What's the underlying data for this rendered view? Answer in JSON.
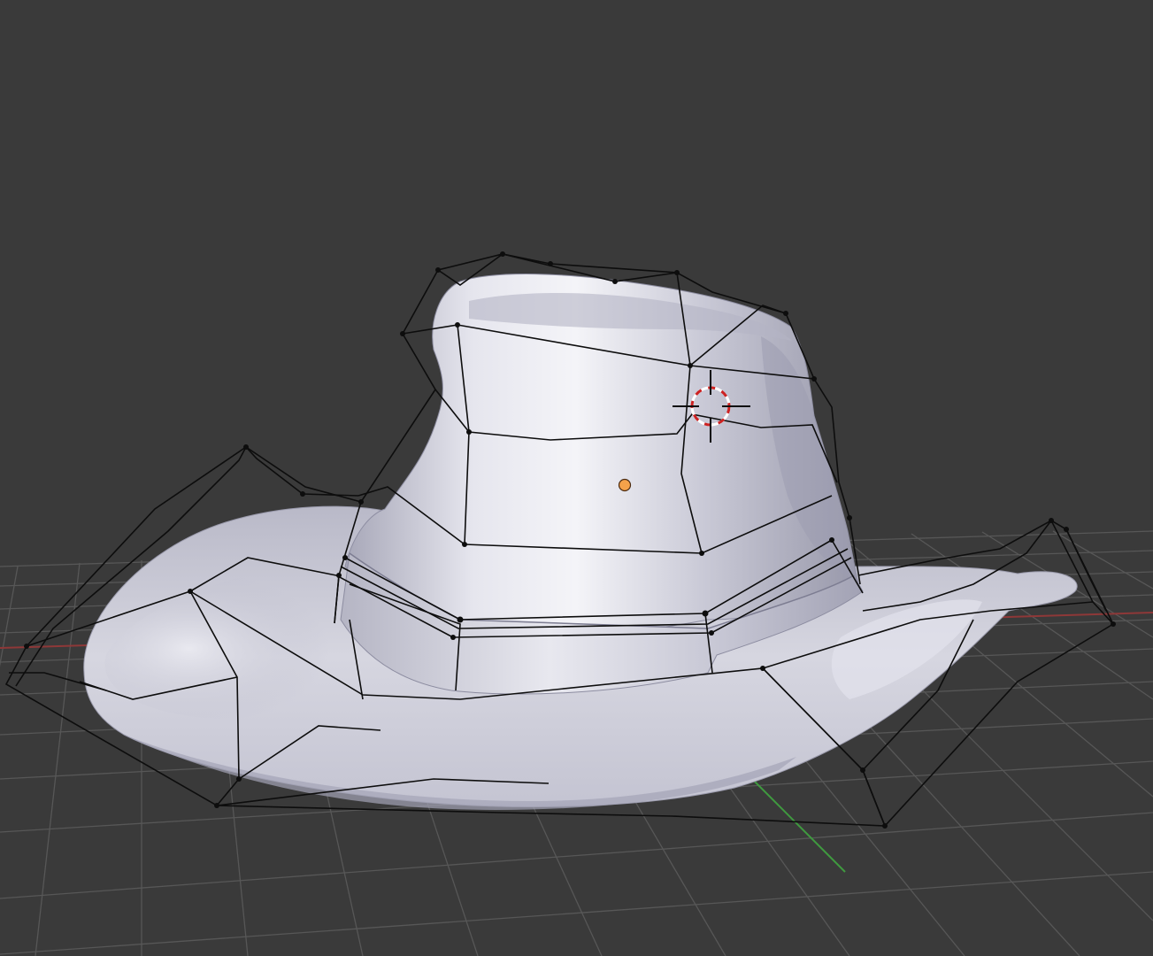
{
  "app": {
    "name": "3D Viewport"
  },
  "viewport": {
    "background_color": "#3a3a3a",
    "grid_color": "#5a5a5a",
    "x_axis_color": "#9a3b3b",
    "y_axis_color": "#3f9a3f",
    "mesh_color": "#c8c8d6",
    "cage_color": "#0d0d0d",
    "origin_color": "#f4a24a",
    "cursor_color": "#cc2222",
    "shading": "smooth",
    "overlay": "wireframe-cage"
  },
  "icons": {
    "cursor": "3d-cursor-icon",
    "origin": "object-origin-icon"
  }
}
